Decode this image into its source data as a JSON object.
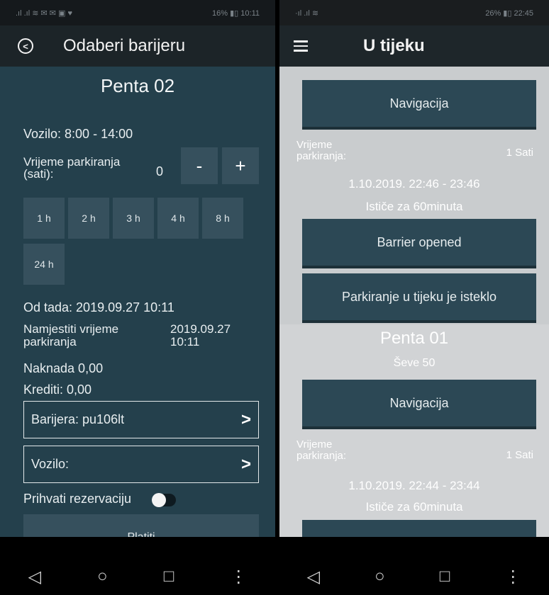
{
  "left": {
    "status": {
      "left_icons": ".ıl .ıl ≋ ✉ ✉ ▣ ♥",
      "right": "16% ▮▯ 10:11"
    },
    "appbar": {
      "title": "Odaberi barijeru"
    },
    "lot_name": "Penta 02",
    "vehicle_hours": "Vozilo: 8:00 - 14:00",
    "parking_time_label": "Vrijeme parkiranja (sati):",
    "parking_time_value": "0",
    "minus_label": "-",
    "plus_label": "+",
    "hour_options": [
      "1 h",
      "2 h",
      "3 h",
      "4 h",
      "8 h",
      "24 h"
    ],
    "from_now": "Od tada: 2019.09.27 10:11",
    "set_time_label": "Namjestiti vrijeme parkiranja",
    "set_time_value": "2019.09.27 10:11",
    "fee": "Naknada 0,00",
    "credits": "Krediti: 0,00",
    "barrier_select": "Barijera: pu106lt",
    "vehicle_select": "Vozilo:",
    "accept_reservation": "Prihvati rezervaciju",
    "pay_button": "Platiti"
  },
  "right": {
    "status": {
      "left_icons": "·ıl .ıl ≋",
      "right": "26% ▮▯ 22:45"
    },
    "appbar": {
      "title": "U tijeku"
    },
    "card1": {
      "nav_button": "Navigacija",
      "time_label": "Vrijeme parkiranja:",
      "time_value": "1 Sati",
      "range": "1.10.2019. 22:46 - 23:46",
      "expires": "Ističe za  60minuta",
      "barrier_button": "Barrier opened",
      "expired_button": "Parkiranje u tijeku je isteklo"
    },
    "card2": {
      "lot_name": "Penta 01",
      "address": "Ševe 50",
      "nav_button": "Navigacija",
      "time_label": "Vrijeme parkiranja:",
      "time_value": "1 Sati",
      "range": "1.10.2019. 22:44 - 23:44",
      "expires": "Ističe za  60minuta"
    }
  },
  "navbar": {
    "back": "◁",
    "home": "○",
    "recents": "□",
    "more": "⋮"
  }
}
